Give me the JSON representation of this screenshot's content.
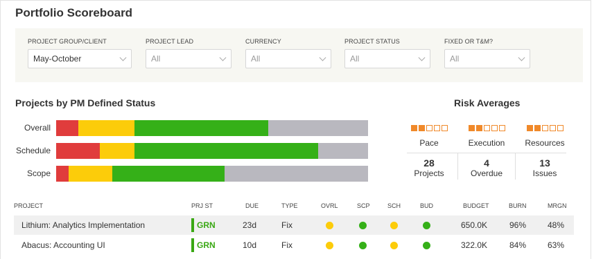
{
  "title": "Portfolio Scoreboard",
  "filters": [
    {
      "label": "PROJECT GROUP/CLIENT",
      "value": "May-October",
      "filled": true
    },
    {
      "label": "PROJECT LEAD",
      "value": "All",
      "filled": false
    },
    {
      "label": "CURRENCY",
      "value": "All",
      "filled": false
    },
    {
      "label": "PROJECT STATUS",
      "value": "All",
      "filled": false
    },
    {
      "label": "FIXED OR T&M?",
      "value": "All",
      "filled": false
    }
  ],
  "status_section": {
    "title": "Projects by PM Defined Status",
    "colors": {
      "red": "#e03c3c",
      "yellow": "#fccc0a",
      "green": "#35b018",
      "gray": "#b9b8bf"
    },
    "rows": [
      {
        "label": "Overall",
        "red": 7,
        "yellow": 18,
        "green": 43,
        "gray": 32
      },
      {
        "label": "Schedule",
        "red": 14,
        "yellow": 11,
        "green": 59,
        "gray": 16
      },
      {
        "label": "Scope",
        "red": 4,
        "yellow": 14,
        "green": 36,
        "gray": 46
      }
    ]
  },
  "risk": {
    "title": "Risk Averages",
    "items": [
      {
        "name": "Pace",
        "level": 2,
        "max": 5
      },
      {
        "name": "Execution",
        "level": 2,
        "max": 5
      },
      {
        "name": "Resources",
        "level": 2,
        "max": 5
      }
    ],
    "stats": [
      {
        "num": "28",
        "label": "Projects"
      },
      {
        "num": "4",
        "label": "Overdue"
      },
      {
        "num": "13",
        "label": "Issues"
      }
    ]
  },
  "table": {
    "headers": {
      "project": "PROJECT",
      "prj_st": "PRJ ST",
      "due": "DUE",
      "type": "TYPE",
      "ovrl": "OVRL",
      "scp": "SCP",
      "sch": "SCH",
      "bud": "BUD",
      "budget": "BUDGET",
      "burn": "BURN",
      "mrgn": "MRGN"
    },
    "dot_colors": {
      "yellow": "#fccc0a",
      "green": "#35b018"
    },
    "rows": [
      {
        "project": "Lithium: Analytics Implementation",
        "prj_st": "GRN",
        "due": "23d",
        "type": "Fix",
        "ovrl": "yellow",
        "scp": "green",
        "sch": "yellow",
        "bud": "green",
        "budget": "650.0K",
        "burn": "96%",
        "mrgn": "48%"
      },
      {
        "project": "Abacus: Accounting UI",
        "prj_st": "GRN",
        "due": "10d",
        "type": "Fix",
        "ovrl": "yellow",
        "scp": "green",
        "sch": "yellow",
        "bud": "green",
        "budget": "322.0K",
        "burn": "84%",
        "mrgn": "63%"
      }
    ]
  }
}
